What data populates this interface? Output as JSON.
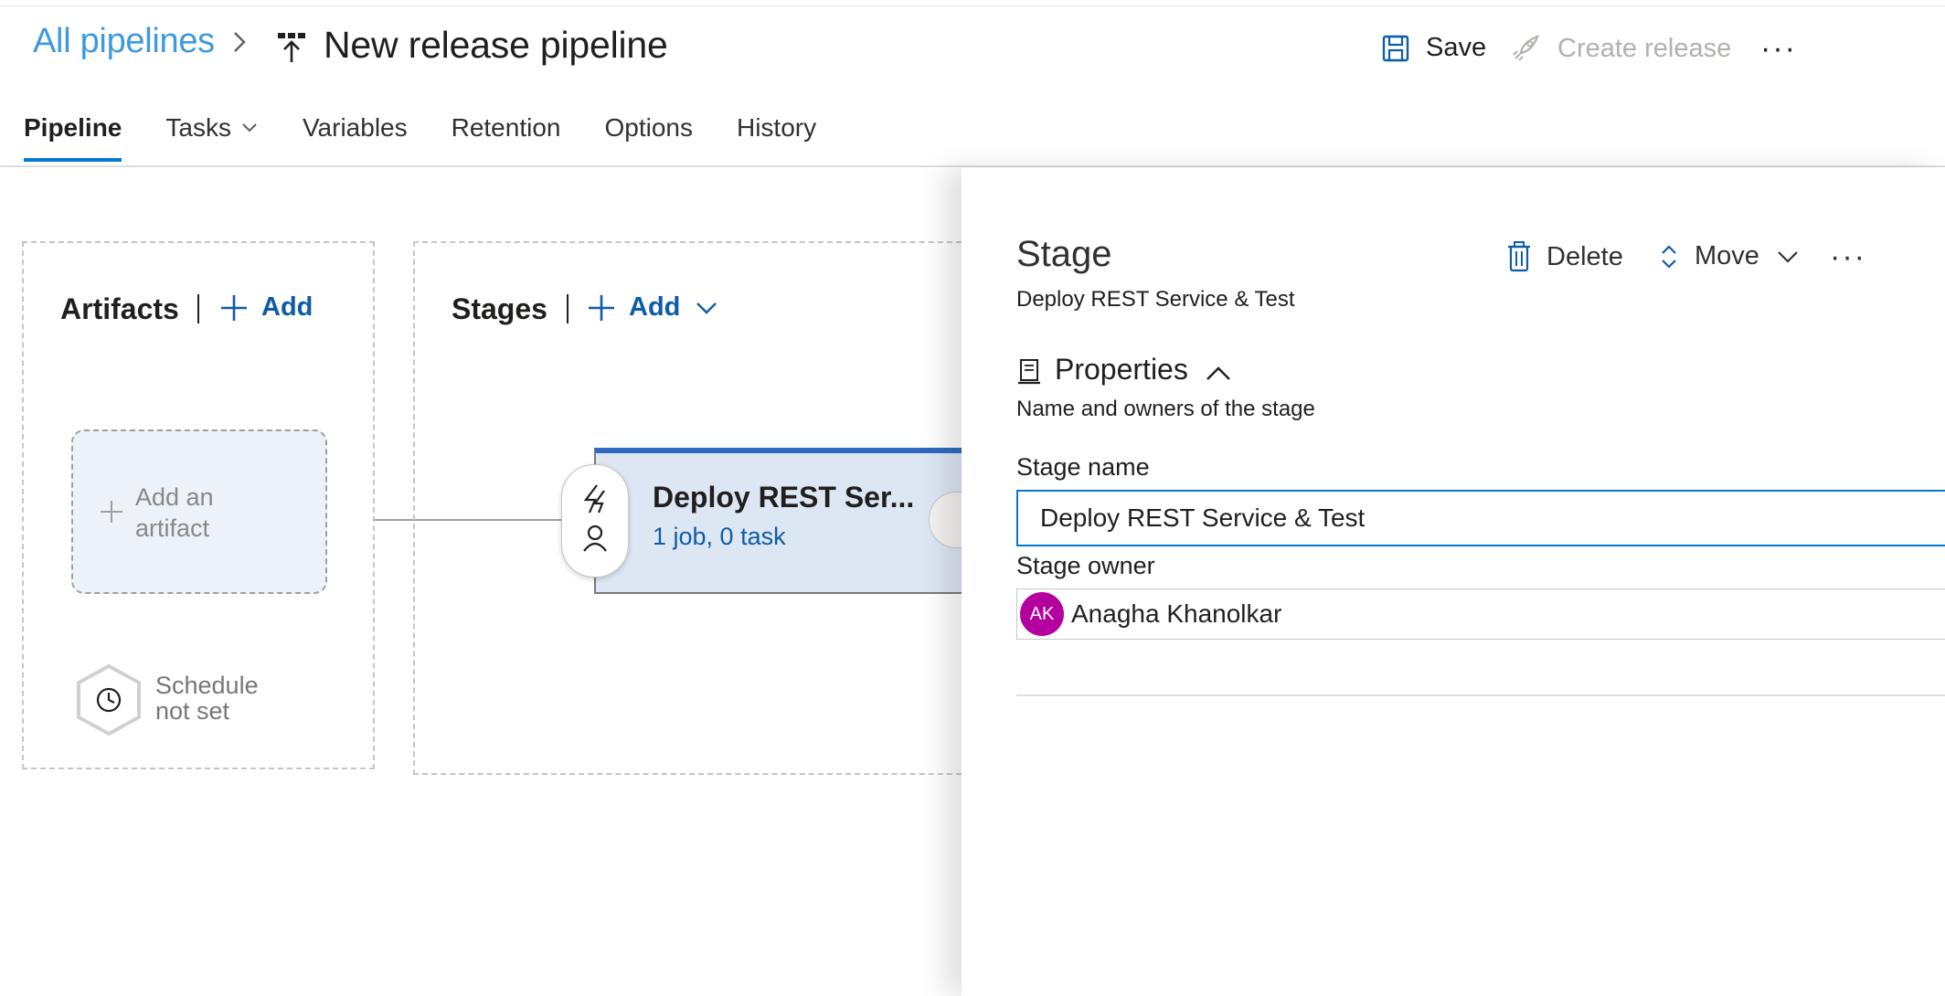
{
  "header": {
    "breadcrumb_link": "All pipelines",
    "title": "New release pipeline",
    "save_label": "Save",
    "create_release_label": "Create release",
    "more_label": "···"
  },
  "tabs": [
    {
      "label": "Pipeline",
      "active": true
    },
    {
      "label": "Tasks",
      "active": false,
      "has_dropdown": true
    },
    {
      "label": "Variables",
      "active": false
    },
    {
      "label": "Retention",
      "active": false
    },
    {
      "label": "Options",
      "active": false
    },
    {
      "label": "History",
      "active": false
    }
  ],
  "artifacts": {
    "title": "Artifacts",
    "add_label": "Add",
    "placeholder_line1": "Add an",
    "placeholder_line2": "artifact",
    "schedule_line1": "Schedule",
    "schedule_line2": "not set"
  },
  "stages": {
    "title": "Stages",
    "add_label": "Add",
    "card_title": "Deploy REST Ser...",
    "card_subtitle": "1 job, 0 task"
  },
  "panel": {
    "title": "Stage",
    "subtitle": "Deploy REST Service & Test",
    "delete_label": "Delete",
    "move_label": "Move",
    "more_label": "···",
    "properties_title": "Properties",
    "properties_desc": "Name and owners of the stage",
    "stage_name_label": "Stage name",
    "stage_name_value": "Deploy REST Service & Test",
    "stage_owner_label": "Stage owner",
    "owner_initials": "AK",
    "owner_name": "Anagha Khanolkar"
  },
  "colors": {
    "accent": "#0078d4",
    "link": "#0f5ca6",
    "stage_card_bg": "#dde7f4",
    "stage_card_top": "#2f6ac1",
    "avatar_bg": "#b4009e",
    "disabled_text": "#b3b0ad"
  }
}
